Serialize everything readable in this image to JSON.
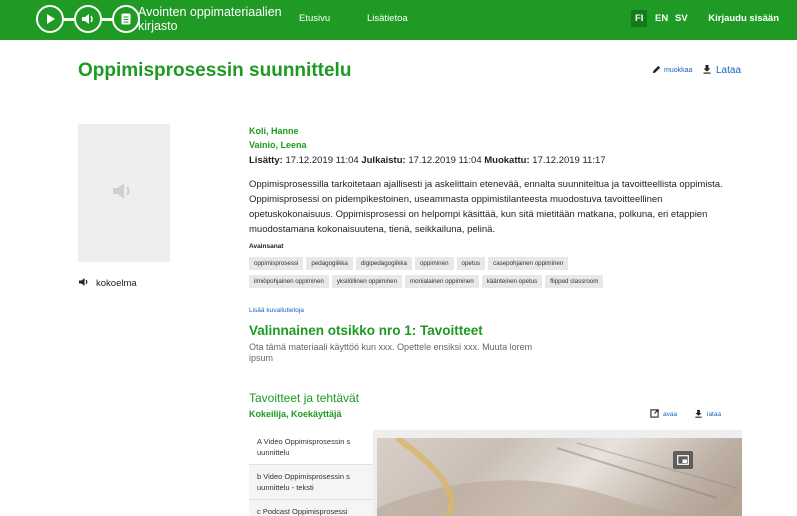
{
  "header": {
    "brand": "Avointen oppimateriaalien kirjasto",
    "nav": [
      "Etusivu",
      "Lisätietoa"
    ],
    "languages": [
      "FI",
      "EN",
      "SV"
    ],
    "active_language": "FI",
    "login": "Kirjaudu sisään",
    "bg_color": "#1f9a25"
  },
  "page": {
    "title": "Oppimisprosessin suunnittelu",
    "edit_label": "muokkaa",
    "download_label": "Lataa",
    "collection_label": "kokoelma"
  },
  "meta": {
    "authors": [
      "Koli, Hanne",
      "Vainio, Leena"
    ],
    "added_label": "Lisätty:",
    "added": "17.12.2019 11:04",
    "published_label": "Julkaistu:",
    "published": "17.12.2019 11:04",
    "modified_label": "Muokattu:",
    "modified": "17.12.2019 11:17",
    "description": "Oppimisprosessilla tarkoitetaan ajallisesti ja askelittain etenevää, ennalta suunniteltua ja tavoitteellista oppimista. Oppimisprosessi on pidempikestoinen, useammasta oppimistilanteesta muodostuva tavoitteellinen opetuskokonaisuus. Oppimisprosessi on helpompi käsittää, kun sitä mietitään matkana, polkuna, eri etappien muodostamana kokonaisuutena, tienä, seikkailuna, pelinä.",
    "keywords_title": "Avainsanat",
    "keywords_row1": [
      "oppimisprosessi",
      "pedagogiikka",
      "digipedagogiikka",
      "oppiminen",
      "opetus",
      "casepohjainen oppiminen"
    ],
    "keywords_row2": [
      "ilmiöpohjainen oppiminen",
      "yksilöllinen oppiminen",
      "monialainen oppiminen",
      "käänteinen opetus",
      "flipped classroom"
    ],
    "more_info": "Lisää kuvailutietoja"
  },
  "optional": {
    "heading": "Valinnainen otsikko nro 1: Tavoitteet",
    "text": "Ota tämä materiaali käyttöö kun xxx. Opettele ensiksi xxx. Muuta lorem ipsum"
  },
  "section": {
    "title": "Tavoitteet ja tehtävät",
    "authors": "Kokeilija, Koekäyttäjä",
    "open_label": "avaa",
    "download_label": "lataa"
  },
  "playlist": [
    "A Video Oppimisprosessin s uunnittelu",
    "b Video Oppimisprosessin s uunnittelu - teksti",
    "c Podcast Oppimisprosessi"
  ],
  "icons": {
    "logo": [
      "play-icon",
      "audio-icon",
      "document-icon"
    ],
    "thumb": "speaker-icon",
    "edit": "pencil-icon",
    "download": "download-icon",
    "open": "open-external-icon",
    "pip": "picture-in-picture-icon"
  }
}
